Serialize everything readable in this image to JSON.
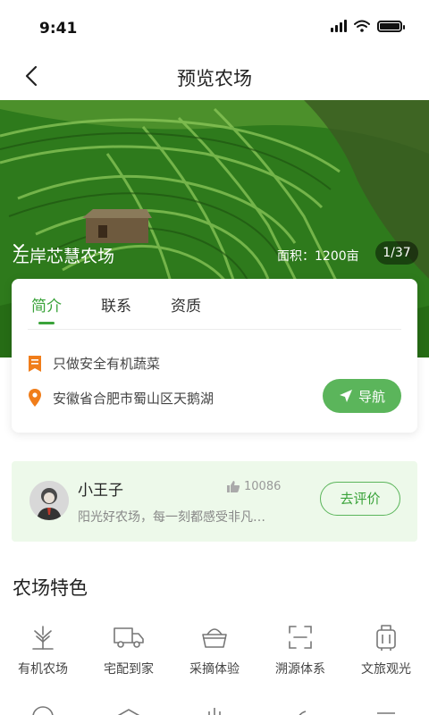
{
  "status_bar": {
    "time": "9:41"
  },
  "nav": {
    "title": "预览农场"
  },
  "hero": {
    "farm_name": "左岸芯慧农场",
    "area": "面积：1200亩",
    "photo_counter": "1/37"
  },
  "info_card": {
    "tabs": [
      {
        "label": "简介",
        "active": true
      },
      {
        "label": "联系",
        "active": false
      },
      {
        "label": "资质",
        "active": false
      }
    ],
    "intro": "只做安全有机蔬菜",
    "address": "安徽省合肥市蜀山区天鹅湖",
    "navigate_label": "导航"
  },
  "review": {
    "name": "小王子",
    "likes": "10086",
    "text": "阳光好农场，每一刻都感受非凡…",
    "button_label": "去评价"
  },
  "features": {
    "title": "农场特色",
    "items": [
      {
        "label": "有机农场",
        "icon": "organic-farm-icon"
      },
      {
        "label": "宅配到家",
        "icon": "delivery-truck-icon"
      },
      {
        "label": "采摘体验",
        "icon": "basket-icon"
      },
      {
        "label": "溯源体系",
        "icon": "scan-icon"
      },
      {
        "label": "文旅观光",
        "icon": "luggage-icon"
      }
    ]
  },
  "colors": {
    "accent": "#3aa33a",
    "button_green": "#5bb55b",
    "review_bg": "#edf9ea",
    "icon_orange": "#f07d1a"
  }
}
